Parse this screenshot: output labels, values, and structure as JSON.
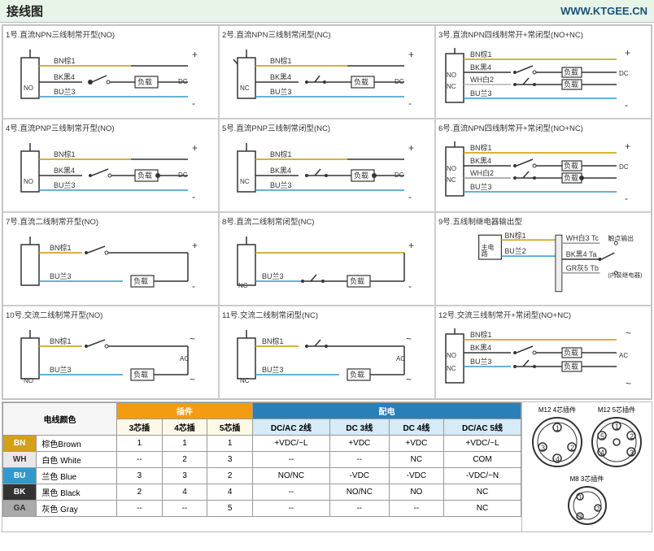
{
  "header": {
    "title": "接线图",
    "url": "WWW.KTGEE.CN"
  },
  "diagrams": [
    {
      "id": 1,
      "title": "1号.直流NPN三线制常开型(NO)",
      "labels": {
        "bn": "BN棕1",
        "bk": "BK黑4",
        "bu": "BU兰3",
        "sw": "NO",
        "dc": "DC",
        "load": "负载"
      }
    },
    {
      "id": 2,
      "title": "2号.直流NPN三线制常闭型(NC)",
      "labels": {
        "bn": "BN棕1",
        "bk": "BK黑4",
        "bu": "BU兰3",
        "sw": "NC",
        "dc": "DC",
        "load": "负载"
      }
    },
    {
      "id": 3,
      "title": "3号.直流NPN四线制常开+常闭型(NO+NC)",
      "labels": {
        "bn": "BN棕1",
        "bk": "BK黑4",
        "wh": "WH白2",
        "bu": "BU兰3",
        "no": "NO",
        "nc": "NC",
        "dc": "DC",
        "load1": "负载",
        "load2": "负载"
      }
    },
    {
      "id": 4,
      "title": "4号.直流PNP三线制常开型(NO)",
      "labels": {
        "bn": "BN棕1",
        "bk": "BK黑4",
        "bu": "BU兰3",
        "sw": "NO",
        "dc": "DC",
        "load": "负载"
      }
    },
    {
      "id": 5,
      "title": "5号.直流PNP三线制常闭型(NC)",
      "labels": {
        "bn": "BN棕1",
        "bk": "BK黑4",
        "bu": "BU兰3",
        "sw": "NC",
        "dc": "DC",
        "load": "负载"
      }
    },
    {
      "id": 6,
      "title": "6号.直流NPN四线制常开+常闭型(NO+NC)",
      "labels": {
        "bn": "BN棕1",
        "bk": "BK黑4",
        "wh": "WH白2",
        "bu": "BU兰3",
        "no": "NO",
        "nc": "NC",
        "dc": "DC",
        "load1": "负载",
        "load2": "负载"
      }
    },
    {
      "id": 7,
      "title": "7号.直流二线制常开型(NO)",
      "labels": {
        "bn": "BN棕1",
        "bu": "BU兰3",
        "load": "负载"
      }
    },
    {
      "id": 8,
      "title": "8号.直流二线制常闭型(NC)",
      "labels": {
        "bu": "BU兰3",
        "load": "负载",
        "nc": "NC"
      }
    },
    {
      "id": 9,
      "title": "9号.五线制继电器输出型",
      "labels": {
        "bn": "BN棕1",
        "bu": "BU兰2",
        "wh": "WH白3",
        "bk": "BK黑4",
        "ga": "GR灰5",
        "tc": "Tc",
        "ta": "Ta",
        "tb": "Tb",
        "main": "主电路",
        "contact": "触点输出",
        "relay": "(内装继电器)"
      }
    },
    {
      "id": 10,
      "title": "10号.交流二线制常开型(NO)",
      "labels": {
        "bn": "BN棕1",
        "bu": "BU兰3",
        "sw": "NO",
        "ac": "AC",
        "load": "负载"
      }
    },
    {
      "id": 11,
      "title": "11号.交流二线制常闭型(NC)",
      "labels": {
        "bn": "BN棕1",
        "bu": "BU兰3",
        "sw": "NC",
        "ac": "AC",
        "load": "负载"
      }
    },
    {
      "id": 12,
      "title": "12号.交流三线制常开+常闭型(NO+NC)",
      "labels": {
        "bn": "BN棕1",
        "bk": "BK黑4",
        "bu": "BU兰3",
        "no": "NO",
        "nc": "NC",
        "ac": "AC",
        "load1": "负载",
        "load2": "负载"
      }
    }
  ],
  "table": {
    "section_labels": {
      "wire_color": "电线颜色",
      "connector": "插件",
      "power": "配电"
    },
    "connector_cols": [
      "3芯插",
      "4芯插",
      "5芯插"
    ],
    "power_cols": [
      "DC/AC 2线",
      "DC 3线",
      "DC 4线",
      "DC/AC 5线"
    ],
    "rows": [
      {
        "code": "BN",
        "color_cn": "棕色Brown",
        "c3": "1",
        "c4": "1",
        "c5": "1",
        "p2": "+VDC/~L",
        "p3": "+VDC",
        "p4": "+VDC",
        "p5": "+VDC/~L"
      },
      {
        "code": "WH",
        "color_cn": "白色 White",
        "c3": "--",
        "c4": "2",
        "c5": "3",
        "p2": "--",
        "p3": "--",
        "p4": "NC",
        "p5": "COM"
      },
      {
        "code": "BU",
        "color_cn": "兰色 Blue",
        "c3": "3",
        "c4": "3",
        "c5": "2",
        "p2": "NO/NC",
        "p3": "-VDC",
        "p4": "-VDC",
        "p5": "-VDC/~N"
      },
      {
        "code": "BK",
        "color_cn": "黑色 Black",
        "c3": "2",
        "c4": "4",
        "c5": "4",
        "p2": "--",
        "p3": "NO/NC",
        "p4": "NO",
        "p5": "NC"
      },
      {
        "code": "GA",
        "color_cn": "灰色 Gray",
        "c3": "--",
        "c4": "--",
        "c5": "5",
        "p2": "--",
        "p3": "--",
        "p4": "--",
        "p5": "NC"
      }
    ],
    "connector_info": {
      "m12_4_label": "M12 4芯插件",
      "m12_5_label": "M12 5芯插件",
      "m8_3_label": "M8 3芯插件"
    }
  },
  "colors": {
    "header_bg": "#e8f4e8",
    "diagram_bg": "#ffffff",
    "orange": "#f39c12",
    "blue": "#2980b9",
    "bn_color": "#cc9900",
    "bu_color": "#3399cc",
    "bk_color": "#333333",
    "wh_color": "#e8e8e8",
    "ga_color": "#999999"
  }
}
